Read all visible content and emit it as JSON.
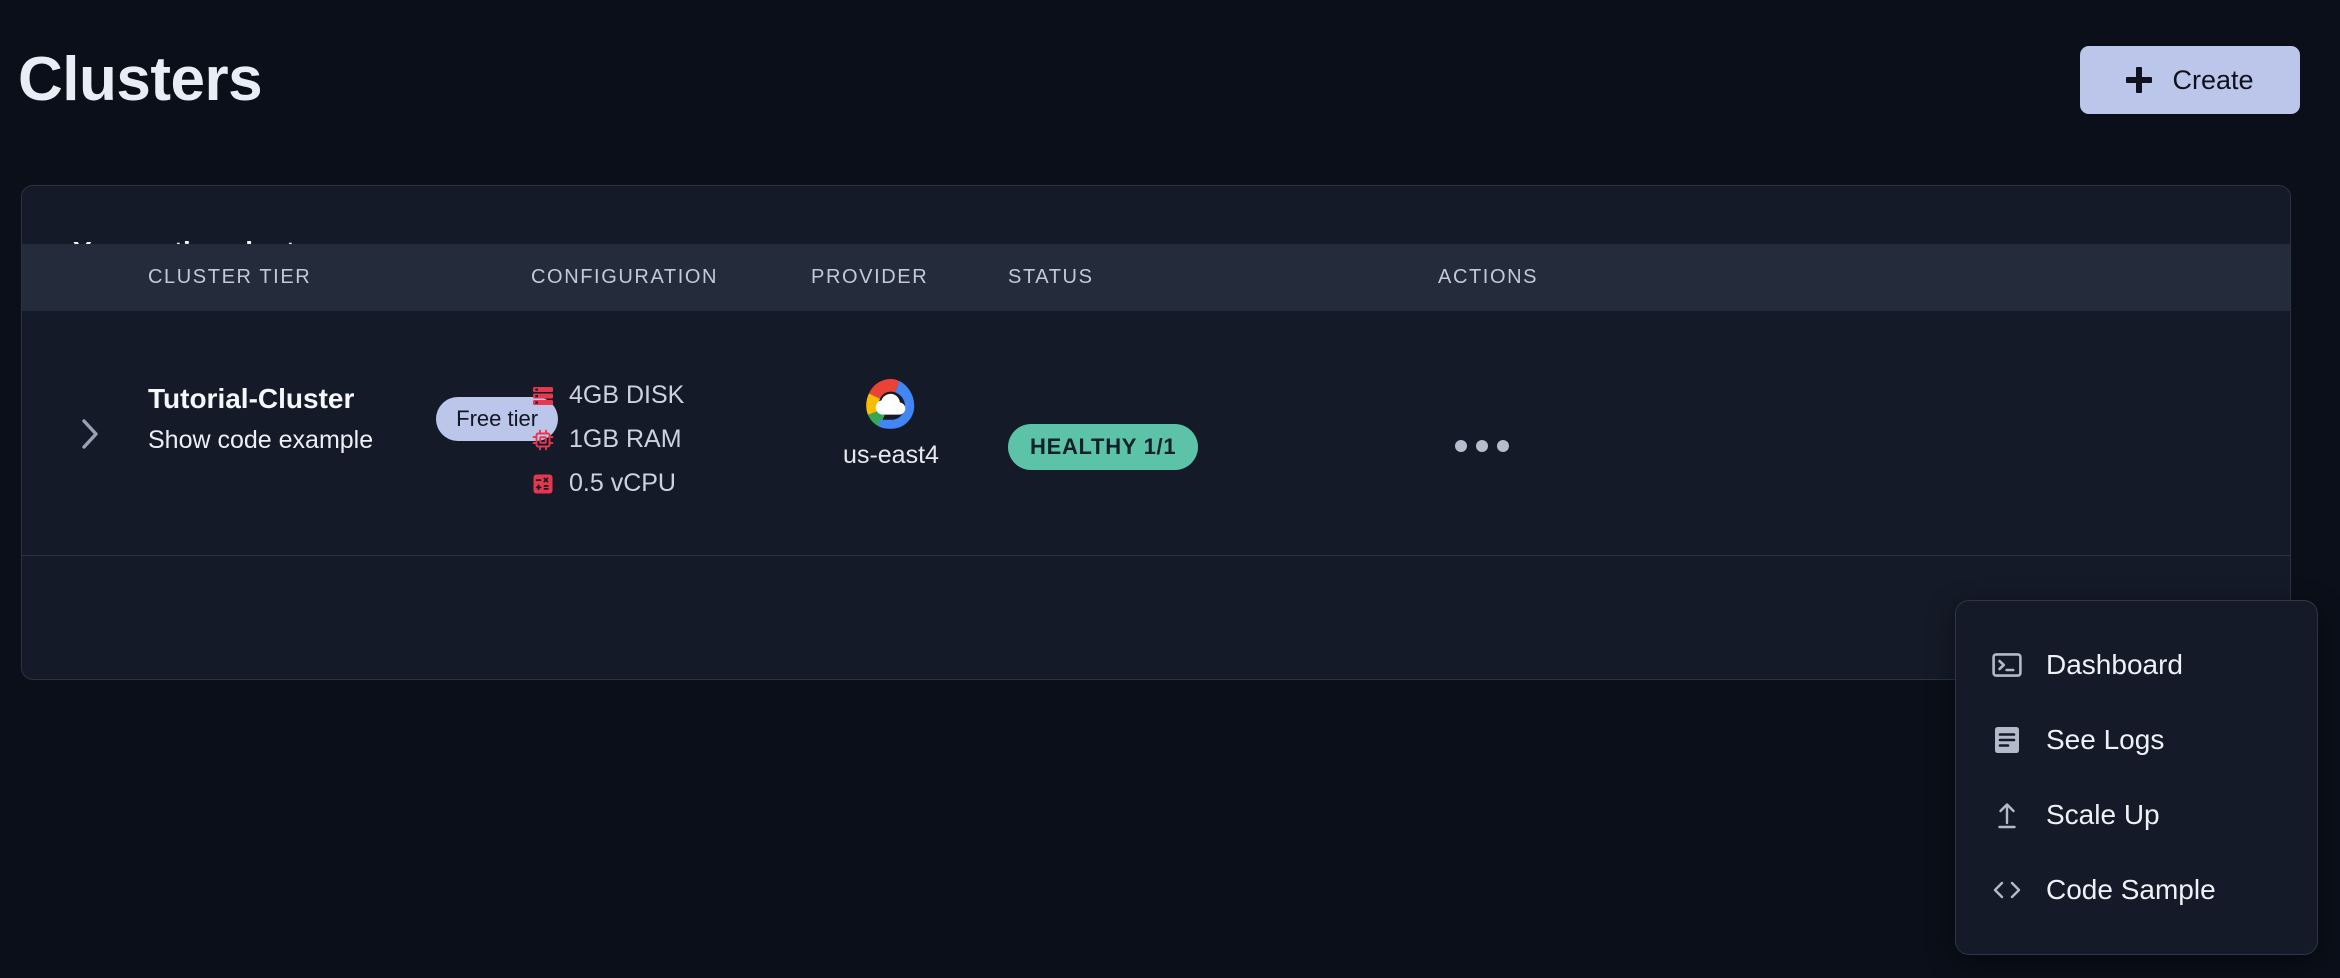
{
  "header": {
    "title": "Clusters",
    "create_label": "Create",
    "create_icon": "plus-icon",
    "create_bg": "#bcc6ea"
  },
  "card": {
    "title": "Your active clusters",
    "columns": [
      {
        "key": "tier",
        "label": "CLUSTER TIER"
      },
      {
        "key": "config",
        "label": "CONFIGURATION"
      },
      {
        "key": "prov",
        "label": "PROVIDER"
      },
      {
        "key": "status",
        "label": "STATUS"
      },
      {
        "key": "act",
        "label": "ACTIONS"
      }
    ],
    "row": {
      "expand_icon": "chevron-right-icon",
      "cluster_name": "Tutorial-Cluster",
      "cluster_sub": "Show code example",
      "tier_badge": "Free tier",
      "tier_badge_bg": "#bcc6ea",
      "configuration": [
        {
          "icon": "disk-icon",
          "label": "4GB DISK",
          "color": "#e7374f"
        },
        {
          "icon": "ram-chip-icon",
          "label": "1GB RAM",
          "color": "#e7374f"
        },
        {
          "icon": "vcpu-calculator-icon",
          "label": "0.5 vCPU",
          "color": "#e7374f"
        }
      ],
      "provider": {
        "icon": "google-cloud-icon",
        "region": "us-east4",
        "colors": {
          "red": "#ea4335",
          "yellow": "#fbbc05",
          "green": "#34a853",
          "blue": "#4285f4"
        }
      },
      "status": {
        "label": "HEALTHY 1/1",
        "bg": "#5cc3a8",
        "fg": "#12202a"
      },
      "actions_icon": "more-horizontal-icon"
    }
  },
  "dropdown": {
    "items": [
      {
        "icon": "terminal-icon",
        "label": "Dashboard"
      },
      {
        "icon": "logs-document-icon",
        "label": "See Logs"
      },
      {
        "icon": "upload-arrow-icon",
        "label": "Scale Up"
      },
      {
        "icon": "code-brackets-icon",
        "label": "Code Sample"
      }
    ]
  }
}
